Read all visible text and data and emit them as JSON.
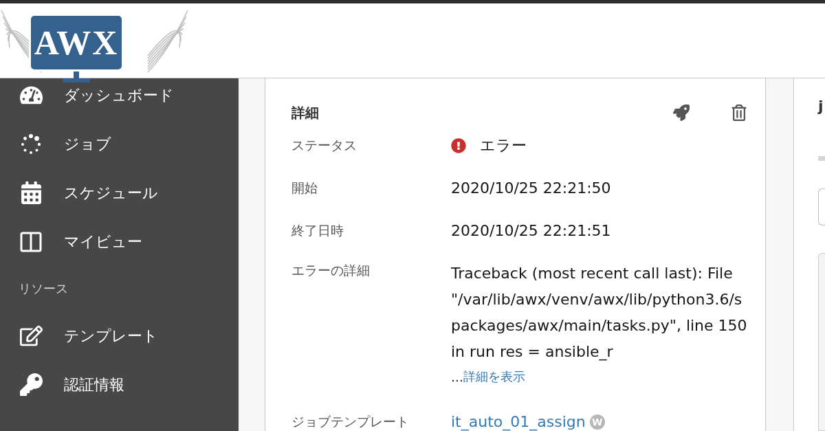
{
  "header": {
    "logo": "AWX"
  },
  "sidebar": {
    "items": [
      {
        "kind": "item",
        "label": "ダッシュボード"
      },
      {
        "kind": "item",
        "label": "ジョブ"
      },
      {
        "kind": "item",
        "label": "スケジュール"
      },
      {
        "kind": "item",
        "label": "マイビュー"
      },
      {
        "kind": "section",
        "label": "リソース"
      },
      {
        "kind": "item",
        "label": "テンプレート"
      },
      {
        "kind": "item",
        "label": "認証情報"
      }
    ]
  },
  "details": {
    "title": "詳細",
    "rows": [
      {
        "kind": "status",
        "label": "ステータス",
        "value": "エラー"
      },
      {
        "kind": "text",
        "label": "開始",
        "value": "2020/10/25 22:21:50"
      },
      {
        "kind": "text",
        "label": "終了日時",
        "value": "2020/10/25 22:21:51"
      },
      {
        "kind": "traceback",
        "label": "エラーの詳細",
        "lines": [
          "Traceback (most recent call last): File",
          "\"/var/lib/awx/venv/awx/lib/python3.6/s",
          "packages/awx/main/tasks.py\", line 150",
          "in run res = ansible_r"
        ],
        "ellipsis": "…",
        "more_link": "詳細を表示"
      },
      {
        "kind": "link",
        "label": "ジョブテンプレート",
        "value": "it_auto_01_assign",
        "badge": "W"
      }
    ]
  },
  "side_panel": {
    "title": "j"
  }
}
